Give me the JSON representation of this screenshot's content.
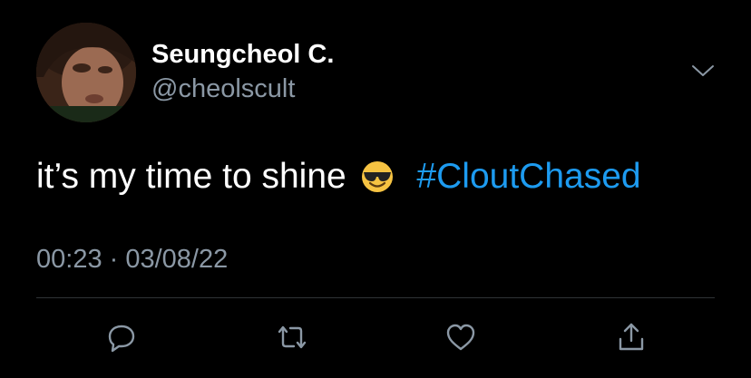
{
  "tweet": {
    "author": {
      "display_name": "Seungcheol C.",
      "handle": "@cheolscult"
    },
    "text": "it’s my time to shine",
    "emoji": "smiling-face-with-sunglasses",
    "hashtag": "#CloutChased",
    "timestamp": "00:23 · 03/08/22"
  },
  "colors": {
    "background": "#000000",
    "text": "#ffffff",
    "secondary": "#8b98a5",
    "link": "#1d9bf0",
    "divider": "#2f3336"
  },
  "actions": [
    {
      "name": "reply",
      "icon": "comment-icon"
    },
    {
      "name": "retweet",
      "icon": "retweet-icon"
    },
    {
      "name": "like",
      "icon": "heart-icon"
    },
    {
      "name": "share",
      "icon": "share-icon"
    }
  ]
}
